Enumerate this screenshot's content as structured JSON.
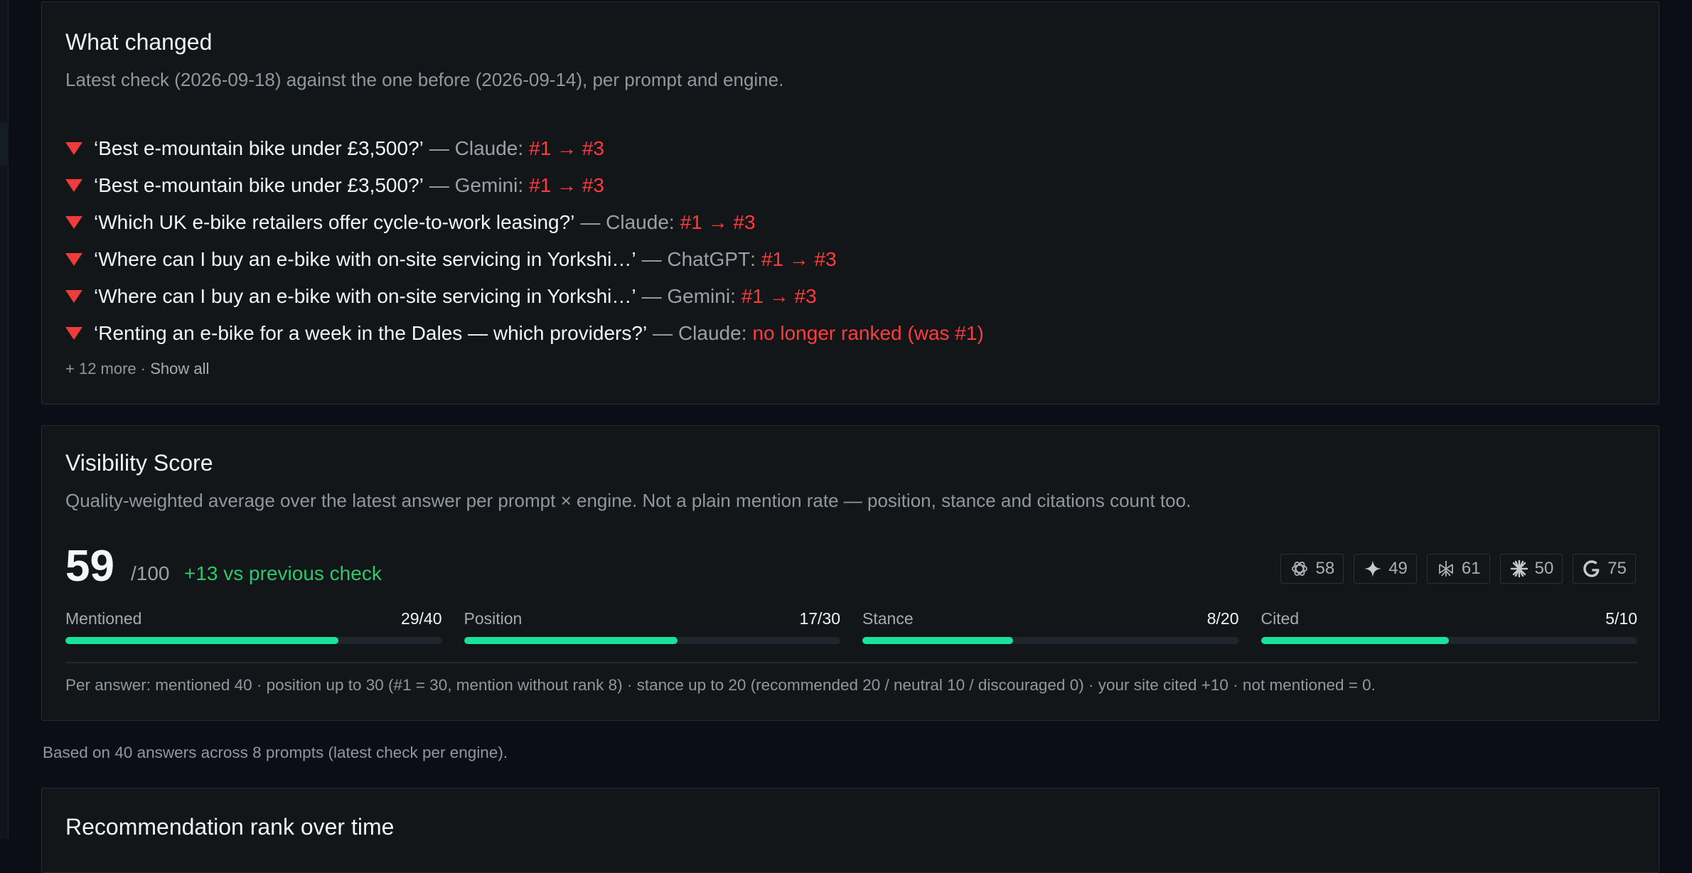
{
  "what_changed": {
    "title": "What changed",
    "subtitle": "Latest check (2026-09-18) against the one before (2026-09-14), per prompt and engine.",
    "items": [
      {
        "prompt": "‘Best e-mountain bike under £3,500?’",
        "engine": "Claude",
        "change": "#1 → #3",
        "direction": "down"
      },
      {
        "prompt": "‘Best e-mountain bike under £3,500?’",
        "engine": "Gemini",
        "change": "#1 → #3",
        "direction": "down"
      },
      {
        "prompt": "‘Which UK e-bike retailers offer cycle-to-work leasing?’",
        "engine": "Claude",
        "change": "#1 → #3",
        "direction": "down"
      },
      {
        "prompt": "‘Where can I buy an e-bike with on-site servicing in Yorkshi…’",
        "engine": "ChatGPT",
        "change": "#1 → #3",
        "direction": "down"
      },
      {
        "prompt": "‘Where can I buy an e-bike with on-site servicing in Yorkshi…’",
        "engine": "Gemini",
        "change": "#1 → #3",
        "direction": "down"
      },
      {
        "prompt": "‘Renting an e-bike for a week in the Dales — which providers?’",
        "engine": "Claude",
        "change": "no longer ranked (was #1)",
        "direction": "down"
      }
    ],
    "more_text": "+ 12 more · ",
    "show_all_label": "Show all",
    "separator": "—",
    "delta_color": "#ff3b3b"
  },
  "visibility_score": {
    "title": "Visibility Score",
    "subtitle": "Quality-weighted average over the latest answer per prompt × engine. Not a plain mention rate — position, stance and citations count too.",
    "score": "59",
    "out_of": "/100",
    "delta": "+13 vs previous check",
    "delta_color": "#2ec76b",
    "engines": [
      {
        "icon": "chatgpt-icon",
        "score": "58"
      },
      {
        "icon": "gemini-icon",
        "score": "49"
      },
      {
        "icon": "perplexity-icon",
        "score": "61"
      },
      {
        "icon": "claude-icon",
        "score": "50"
      },
      {
        "icon": "google-icon",
        "score": "75"
      }
    ],
    "metrics": [
      {
        "name": "Mentioned",
        "value": "29/40",
        "fraction": 0.725
      },
      {
        "name": "Position",
        "value": "17/30",
        "fraction": 0.5667
      },
      {
        "name": "Stance",
        "value": "8/20",
        "fraction": 0.4
      },
      {
        "name": "Cited",
        "value": "5/10",
        "fraction": 0.5
      }
    ],
    "bar_color": "#19e39a",
    "footnote": "Per answer: mentioned 40 · position up to 30 (#1 = 30, mention without rank 8) · stance up to 20 (recommended 20 / neutral 10 / discouraged 0) · your site cited +10 · not mentioned = 0."
  },
  "based_on": "Based on 40 answers across 8 prompts (latest check per engine).",
  "rank_over_time": {
    "title": "Recommendation rank over time"
  }
}
